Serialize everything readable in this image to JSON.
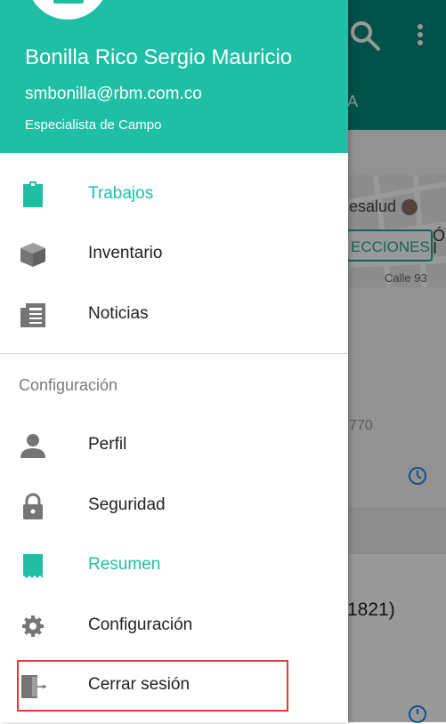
{
  "background": {
    "tab_fragment": "A",
    "map_place": "esalud",
    "directions_label": "ECCIONES",
    "map_side_text": "Ó\nI",
    "map_street": "Calle 93",
    "number_fragment": "770",
    "code_fragment": "1821)"
  },
  "drawer": {
    "user": {
      "name": "Bonilla Rico Sergio Mauricio",
      "email": "smbonilla@rbm.com.co",
      "role": "Especialista de Campo"
    },
    "main_items": [
      {
        "label": "Trabajos",
        "icon": "clipboard-icon",
        "active": true
      },
      {
        "label": "Inventario",
        "icon": "box-icon",
        "active": false
      },
      {
        "label": "Noticias",
        "icon": "newspaper-icon",
        "active": false
      }
    ],
    "section_title": "Configuración",
    "config_items": [
      {
        "label": "Perfil",
        "icon": "person-icon",
        "active": false
      },
      {
        "label": "Seguridad",
        "icon": "lock-icon",
        "active": false
      },
      {
        "label": "Resumen",
        "icon": "receipt-icon",
        "active": true
      },
      {
        "label": "Configuración",
        "icon": "gear-icon",
        "active": false
      },
      {
        "label": "Cerrar sesión",
        "icon": "logout-icon",
        "active": false
      }
    ]
  },
  "colors": {
    "accent": "#1fbfa5",
    "toolbar_bg": "#00897b",
    "icon_gray": "#757575",
    "highlight": "#e53935"
  }
}
